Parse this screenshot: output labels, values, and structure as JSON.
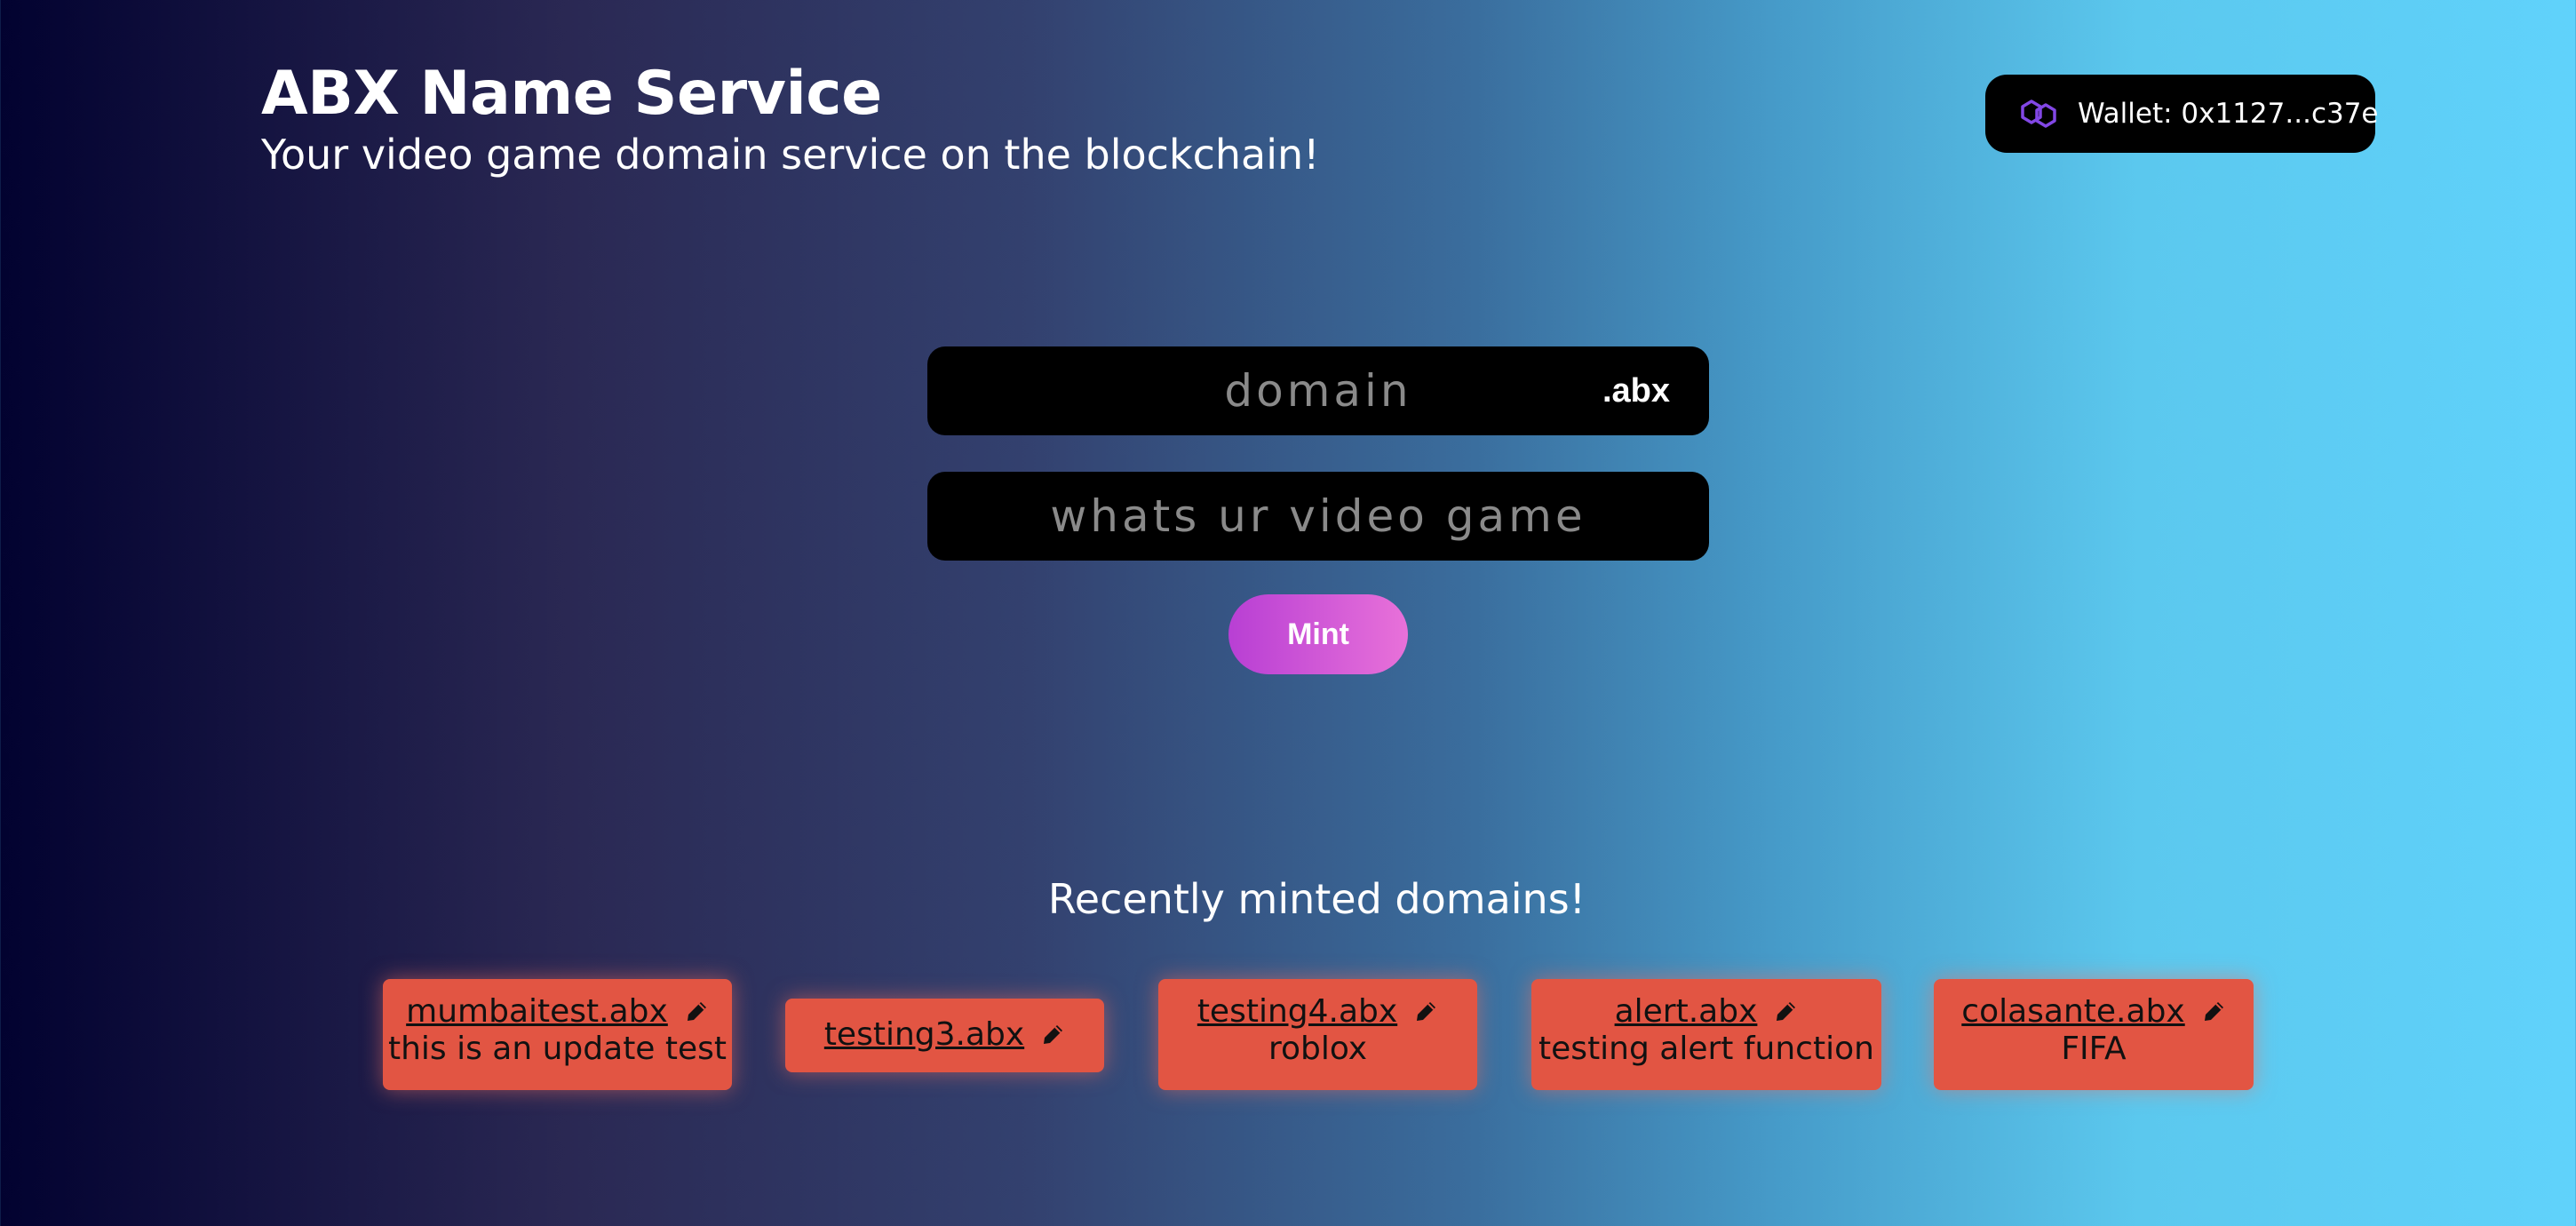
{
  "header": {
    "title": "ABX Name Service",
    "subtitle": "Your video game domain service on the blockchain!"
  },
  "wallet": {
    "icon": "polygon-logo-icon",
    "label": "Wallet: 0x1127...c37e",
    "icon_color": "#8247e5"
  },
  "form": {
    "domain_placeholder": "domain",
    "tld": ".abx",
    "record_placeholder": "whats ur video game",
    "mint_label": "Mint"
  },
  "recent": {
    "title": "Recently minted domains!",
    "items": [
      {
        "name": "mumbaitest.abx",
        "record": "this is an update test"
      },
      {
        "name": "testing3.abx",
        "record": ""
      },
      {
        "name": "testing4.abx",
        "record": "roblox"
      },
      {
        "name": "alert.abx",
        "record": "testing alert function"
      },
      {
        "name": "colasante.abx",
        "record": "FIFA"
      }
    ]
  },
  "colors": {
    "card_bg": "#e25543",
    "mint_gradient_start": "#b83fd4",
    "mint_gradient_end": "#e871d9"
  }
}
